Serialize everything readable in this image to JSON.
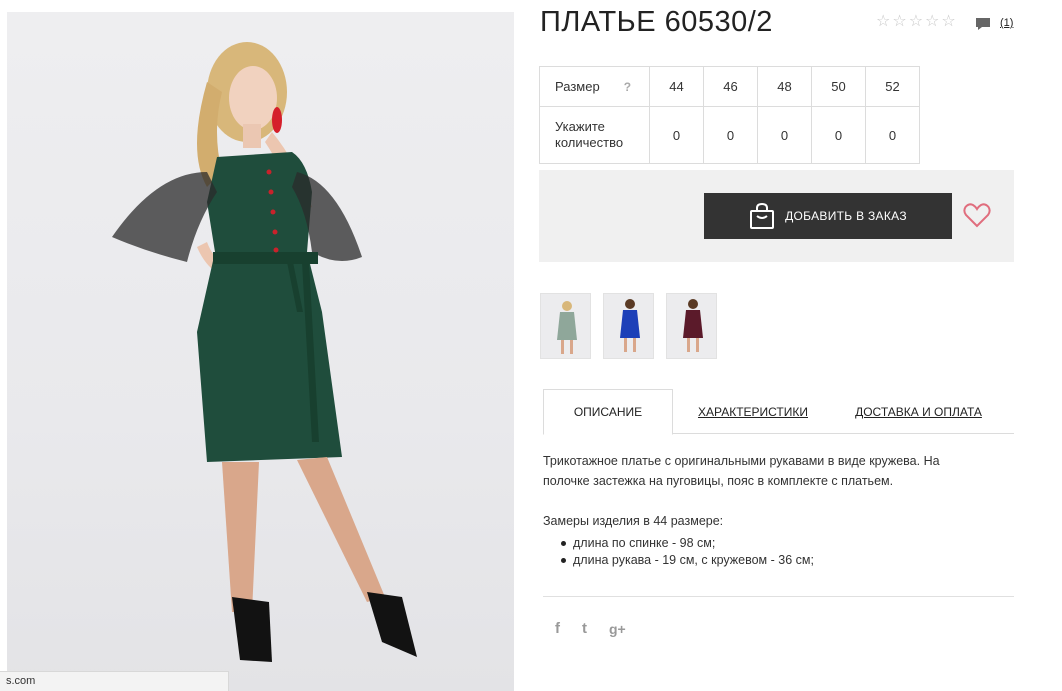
{
  "product": {
    "title": "ПЛАТЬЕ 60530/2",
    "rating_stars": [
      "☆",
      "☆",
      "☆",
      "☆",
      "☆"
    ],
    "review_count": "(1)"
  },
  "size_table": {
    "size_label": "Размер",
    "help_mark": "?",
    "qty_label_line1": "Укажите",
    "qty_label_line2": "количество",
    "sizes": [
      "44",
      "46",
      "48",
      "50",
      "52"
    ],
    "quantities": [
      "0",
      "0",
      "0",
      "0",
      "0"
    ]
  },
  "order": {
    "add_button_label": "ДОБАВИТЬ В ЗАКАЗ",
    "heart_color": "#e06d7d"
  },
  "thumbnails": [
    "green-dress",
    "blue-dress",
    "burgundy-dress"
  ],
  "tabs": {
    "description": "ОПИСАНИЕ",
    "characteristics": "ХАРАКТЕРИСТИКИ",
    "delivery": "ДОСТАВКА И ОПЛАТА"
  },
  "description": {
    "text": "Трикотажное платье с оригинальными рукавами в виде кружева. На полочке застежка на пуговицы, пояс в комплекте с платьем.",
    "measurements_title": "Замеры изделия в 44 размере:",
    "measurements": [
      "длина по спинке - 98 см;",
      "длина рукава - 19 см, с кружевом - 36 см;"
    ]
  },
  "social": {
    "facebook": "f",
    "twitter": "t",
    "googleplus": "g+"
  },
  "status_bar": {
    "url": "s.com"
  },
  "colors": {
    "dress_green": "#1f4d3c",
    "button_dark": "#333333",
    "panel_bg": "#f0f0f0"
  }
}
